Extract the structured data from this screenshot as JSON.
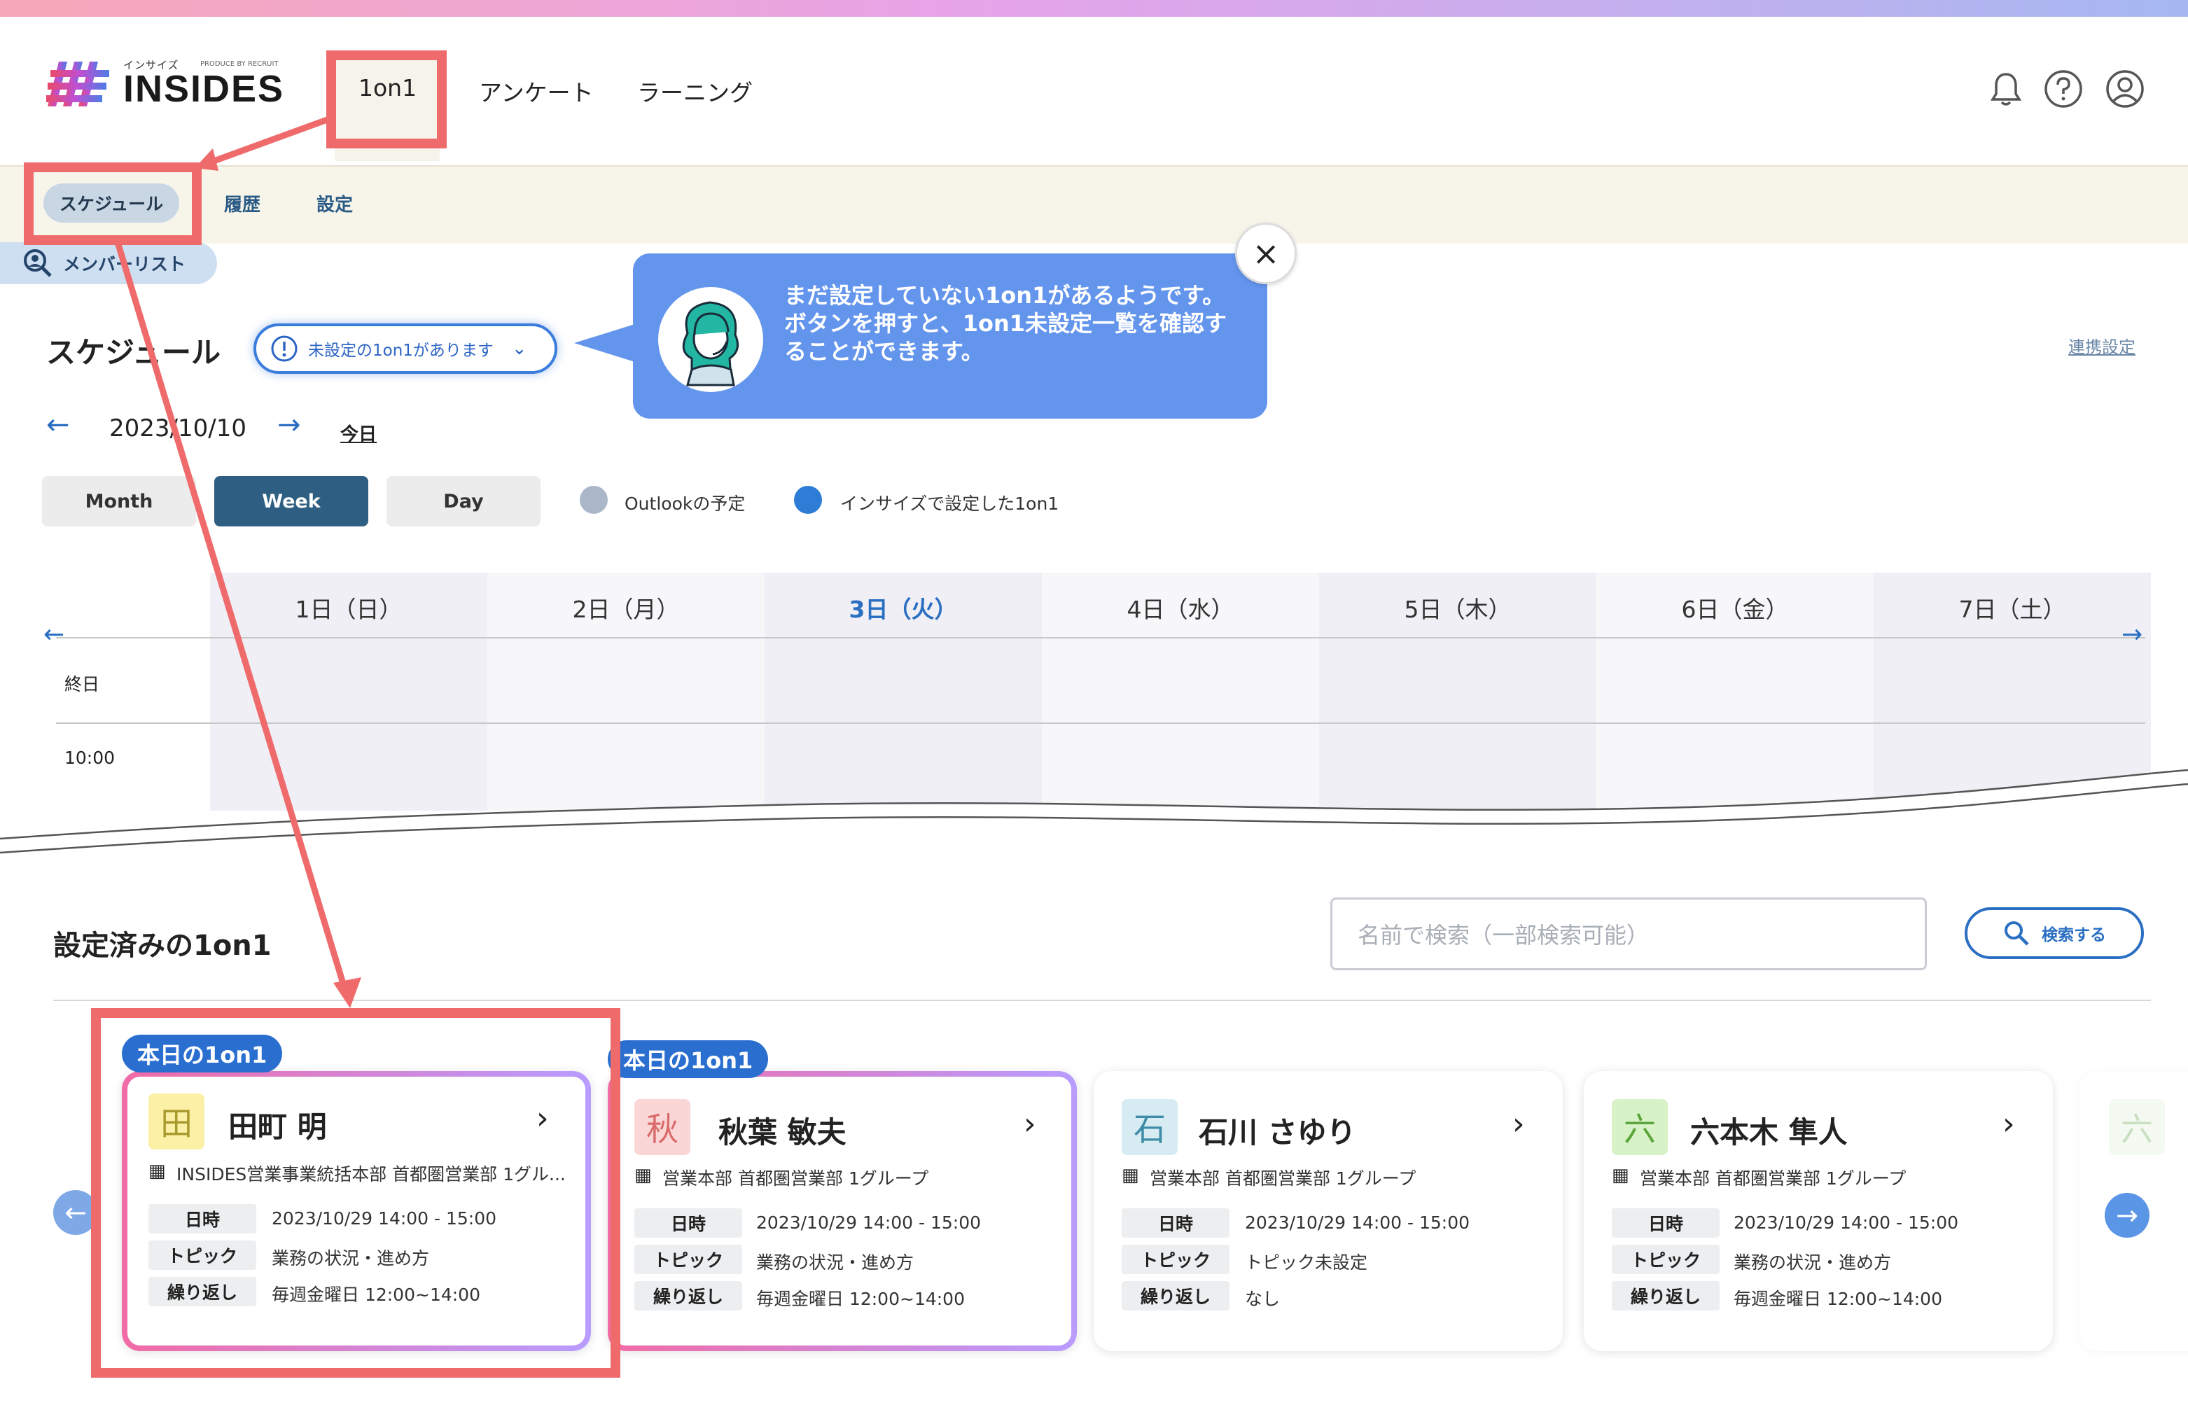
{
  "header": {
    "logo_small": "インサイズ",
    "logo_powered": "PRODUCE BY RECRUIT",
    "logo_text": "INSIDES",
    "tabs": [
      {
        "label": "1on1"
      },
      {
        "label": "アンケート"
      },
      {
        "label": "ラーニング"
      }
    ],
    "icons": [
      "bell-icon",
      "help-icon",
      "user-icon"
    ]
  },
  "subnav": {
    "items": [
      {
        "label": "スケジュール"
      },
      {
        "label": "履歴"
      },
      {
        "label": "設定"
      }
    ],
    "member_list": "メンバーリスト"
  },
  "schedule": {
    "title": "スケジュール",
    "unset_button": "未設定の1on1があります",
    "tooltip": "まだ設定していない1on1があるようです。ボタンを押すと、1on1未設定一覧を確認することができます。",
    "link_settings": "連携設定",
    "date": "2023/10/10",
    "today": "今日",
    "views": [
      {
        "label": "Month"
      },
      {
        "label": "Week"
      },
      {
        "label": "Day"
      }
    ],
    "active_view": "Week",
    "legend": [
      {
        "label": "Outlookの予定",
        "color": "#a9b7c9"
      },
      {
        "label": "インサイズで設定した1on1",
        "color": "#2d7cd6"
      }
    ],
    "days": [
      {
        "label": "1日（日）"
      },
      {
        "label": "2日（月）"
      },
      {
        "label": "3日（火）",
        "today": true
      },
      {
        "label": "4日（水）"
      },
      {
        "label": "5日（木）"
      },
      {
        "label": "6日（金）"
      },
      {
        "label": "7日（土）"
      }
    ],
    "row_labels": [
      "終日",
      "10:00"
    ]
  },
  "configured": {
    "title": "設定済みの1on1",
    "search_placeholder": "名前で検索（一部検索可能）",
    "search_button": "検索する",
    "row_labels": {
      "date": "日時",
      "topic": "トピック",
      "repeat": "繰り返し"
    },
    "cards": [
      {
        "badge": "本日の1on1",
        "kanji": "田",
        "name": "田町 明",
        "dept": "INSIDES営業事業統括本部 首都圏営業部 1グル...",
        "date": "2023/10/29  14:00 - 15:00",
        "topic": "業務の状況・進め方",
        "repeat": "毎週金曜日 12:00~14:00"
      },
      {
        "badge": "本日の1on1",
        "kanji": "秋",
        "name": "秋葉 敏夫",
        "dept": "営業本部 首都圏営業部 1グループ",
        "date": "2023/10/29  14:00 - 15:00",
        "topic": "業務の状況・進め方",
        "repeat": "毎週金曜日 12:00~14:00"
      },
      {
        "badge": "",
        "kanji": "石",
        "name": "石川 さゆり",
        "dept": "営業本部 首都圏営業部 1グループ",
        "date": "2023/10/29  14:00 - 15:00",
        "topic": "トピック未設定",
        "repeat": "なし"
      },
      {
        "badge": "",
        "kanji": "六",
        "name": "六本木 隼人",
        "dept": "営業本部 首都圏営業部 1グループ",
        "date": "2023/10/29  14:00 - 15:00",
        "topic": "業務の状況・進め方",
        "repeat": "毎週金曜日 12:00~14:00"
      }
    ],
    "peek_kanji": "六"
  }
}
